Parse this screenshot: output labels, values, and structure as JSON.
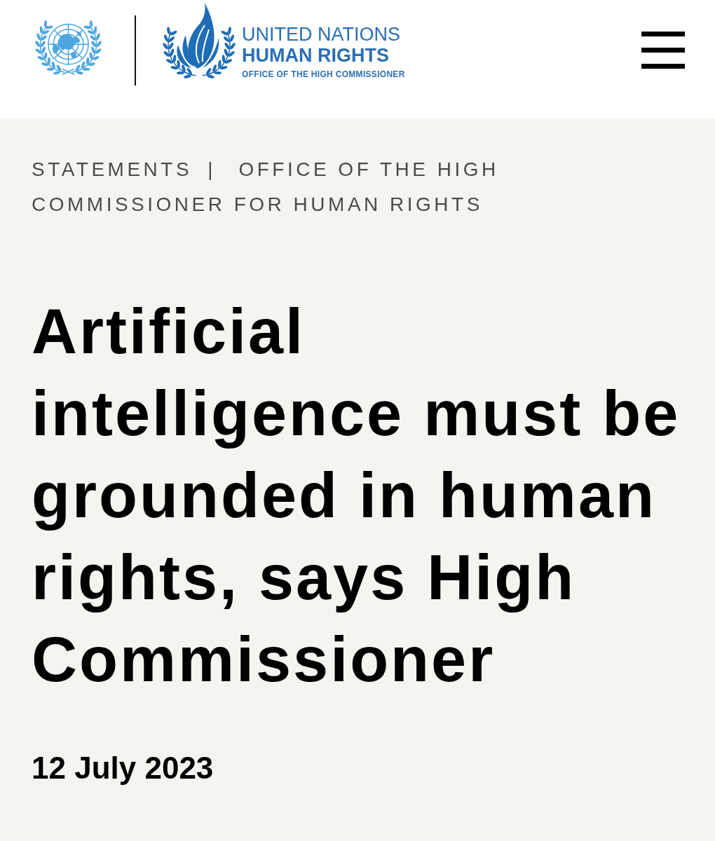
{
  "header": {
    "logo": {
      "line_1": "UNITED NATIONS",
      "line_2": "HUMAN RIGHTS",
      "line_3": "OFFICE OF THE HIGH COMMISSIONER"
    }
  },
  "article": {
    "breadcrumb": {
      "section": "STATEMENTS",
      "separator": "|",
      "office": "OFFICE OF THE HIGH COMMISSIONER FOR HUMAN RIGHTS"
    },
    "title": "Artificial intelligence must be grounded in human rights, says High Commissioner",
    "date": "12 July 2023"
  }
}
